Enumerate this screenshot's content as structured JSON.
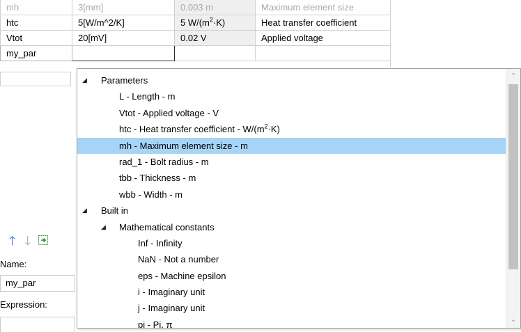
{
  "table": {
    "rows": [
      {
        "name": "mh",
        "expression": "3[mm]",
        "value": "0.003 m",
        "description": "Maximum element size"
      },
      {
        "name": "htc",
        "expression": "5[W/m^2/K]",
        "value": "5 W/(m²·K)",
        "description": "Heat transfer coefficient"
      },
      {
        "name": "Vtot",
        "expression": "20[mV]",
        "value": "0.02 V",
        "description": "Applied voltage"
      },
      {
        "name": "my_par",
        "expression": "",
        "value": "",
        "description": ""
      }
    ]
  },
  "panel": {
    "name_label": "Name:",
    "name_value": "my_par",
    "expression_label": "Expression:"
  },
  "dropdown": {
    "items": [
      {
        "label": "Parameters"
      },
      {
        "label": "L - Length - m"
      },
      {
        "label": "Vtot - Applied voltage - V"
      },
      {
        "label_pre": "htc - Heat transfer coefficient - W/(m",
        "label_sup": "2",
        "label_post": "·K)"
      },
      {
        "label": "mh - Maximum element size - m"
      },
      {
        "label": "rad_1 - Bolt radius - m"
      },
      {
        "label": "tbb - Thickness - m"
      },
      {
        "label": "wbb - Width - m"
      },
      {
        "label": "Built in"
      },
      {
        "label": "Mathematical constants"
      },
      {
        "label": "Inf - Infinity"
      },
      {
        "label": "NaN - Not a number"
      },
      {
        "label": "eps - Machine epsilon"
      },
      {
        "label": "i - Imaginary unit"
      },
      {
        "label": "j - Imaginary unit"
      },
      {
        "label": "pi - Pi, π"
      }
    ]
  },
  "colors": {
    "selection": "#a6d4f5",
    "arrow_up": "#2a6fd6",
    "computed_value_bg": "#efefef"
  }
}
